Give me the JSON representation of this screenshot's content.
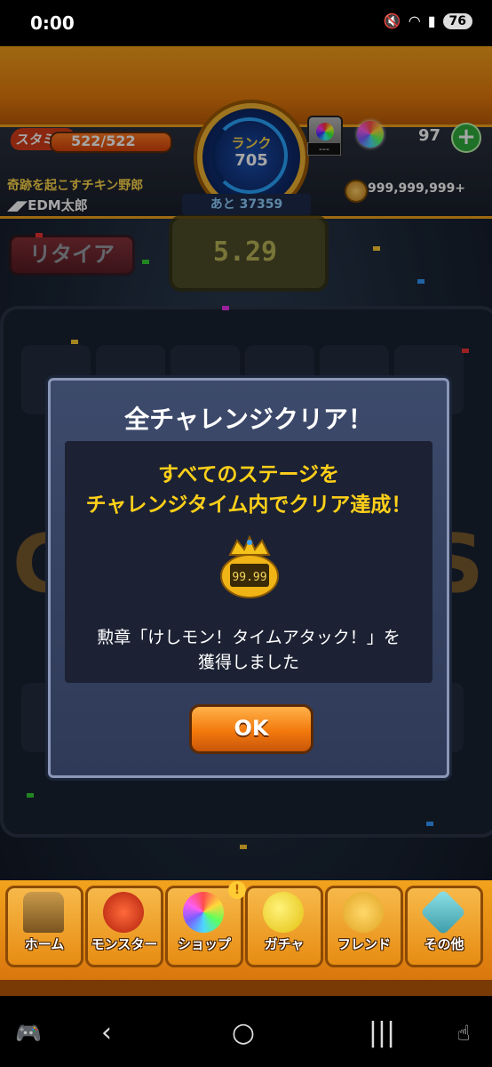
{
  "status_bar": {
    "time": "0:00",
    "battery": "76"
  },
  "hud": {
    "stamina_label": "スタミナ",
    "stamina_value": "522/522",
    "player_title": "奇跡を起こすチキン野郎",
    "player_name": "◢◤EDM太郎",
    "rank_label": "ランク",
    "rank_value": "705",
    "rank_next": "あと 37359",
    "gacha_count": "---",
    "orb_count": "97",
    "coin_count": "999,999,999+",
    "plus_label": "+"
  },
  "stage": {
    "retire_label": "リタイア",
    "timer": "5.29"
  },
  "dialog": {
    "title": "全チャレンジクリア！",
    "message_line1": "すべてのステージを",
    "message_line2": "チャレンジタイム内でクリア達成！",
    "medal_value": "99.99",
    "medal_line1": "勲章「けしモン！タイムアタック！」を",
    "medal_line2": "獲得しました",
    "ok_label": "OK"
  },
  "nav": {
    "items": [
      {
        "label": "ホーム",
        "icon": "home-gate-icon"
      },
      {
        "label": "モンスター",
        "icon": "dragon-icon"
      },
      {
        "label": "ショップ",
        "icon": "rainbow-orb-icon",
        "badge": "!"
      },
      {
        "label": "ガチャ",
        "icon": "gacha-egg-icon"
      },
      {
        "label": "フレンド",
        "icon": "friends-icon"
      },
      {
        "label": "その他",
        "icon": "other-menu-icon"
      }
    ]
  },
  "colors": {
    "accent_orange": "#f2a31c",
    "dialog_yellow_text": "#ffd019",
    "dialog_bg": "#2f3a58"
  }
}
